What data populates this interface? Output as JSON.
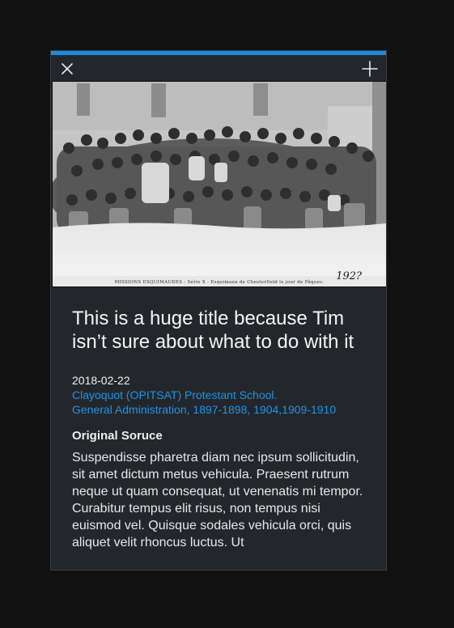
{
  "toolbar": {
    "close_icon": "close-icon",
    "add_icon": "plus-icon"
  },
  "photo": {
    "caption": "MISSIONS ESQUIMAUDES - Série X - Esquimaux de Chesterfield le jour de Pâques.",
    "handwritten": "192?"
  },
  "record": {
    "title": "This is a huge title because Tim isn’t sure about what to do with it",
    "date": "2018-02-22",
    "link_1": "Clayoquot (OPITSAT) Protestant School.",
    "link_2": "General Administration, 1897-1898, 1904,1909-1910",
    "source_heading": "Original Soruce",
    "source_text": "Suspendisse pharetra diam nec ipsum sollicitudin, sit amet dictum metus vehicula. Praesent rutrum neque ut quam consequat, ut venenatis mi tempor. Curabitur tempus elit risus, non tempus nisi euismod vel. Quisque sodales vehicula orci, quis aliquet velit rhoncus luctus. Ut"
  },
  "colors": {
    "accent": "#1a8be0",
    "link": "#1f93ea",
    "panel": "#23272b",
    "background": "#111112"
  }
}
